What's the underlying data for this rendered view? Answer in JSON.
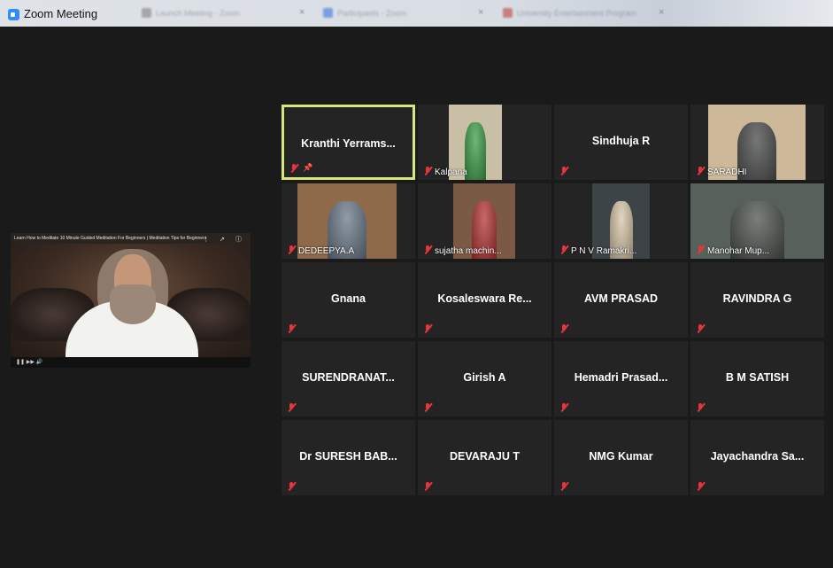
{
  "window": {
    "title": "Zoom Meeting",
    "blurred_tabs": [
      "Launch Meeting - Zoom",
      "Participants - Zoom",
      "University Entertainment Program"
    ]
  },
  "shared_screen": {
    "video_title": "Learn How to Meditate 10 Minute Guided Meditation For Beginners | Meditation Tips for Beginners",
    "controls": "⋮ ➚ ⓘ",
    "progress_fraction": 0.3
  },
  "participants": [
    {
      "name": "Kranthi  Yerrams...",
      "video": false,
      "muted": true,
      "pinned": true,
      "active_speaker": true
    },
    {
      "name": "Kalpana",
      "video": true,
      "muted": true
    },
    {
      "name": "Sindhuja R",
      "video": false,
      "muted": true
    },
    {
      "name": "SARADHI",
      "video": true,
      "muted": true
    },
    {
      "name": "DEDEEPYA.A",
      "video": true,
      "muted": true
    },
    {
      "name": "sujatha machin...",
      "video": true,
      "muted": true
    },
    {
      "name": "P N V Ramakri...",
      "video": true,
      "muted": true
    },
    {
      "name": "Manohar Mup...",
      "video": true,
      "muted": true
    },
    {
      "name": "Gnana",
      "video": false,
      "muted": true
    },
    {
      "name": "Kosaleswara  Re...",
      "video": false,
      "muted": true
    },
    {
      "name": "AVM PRASAD",
      "video": false,
      "muted": true
    },
    {
      "name": "RAVINDRA G",
      "video": false,
      "muted": true
    },
    {
      "name": "SURENDRANAT...",
      "video": false,
      "muted": true
    },
    {
      "name": "Girish A",
      "video": false,
      "muted": true
    },
    {
      "name": "Hemadri  Prasad...",
      "video": false,
      "muted": true
    },
    {
      "name": "B M SATISH",
      "video": false,
      "muted": true
    },
    {
      "name": "Dr SURESH BAB...",
      "video": false,
      "muted": true
    },
    {
      "name": "DEVARAJU T",
      "video": false,
      "muted": true
    },
    {
      "name": "NMG Kumar",
      "video": false,
      "muted": true
    },
    {
      "name": "Jayachandra  Sa...",
      "video": false,
      "muted": true
    }
  ],
  "colors": {
    "active_speaker_border": "#d7e57a",
    "muted_icon": "#e8353b",
    "tile_bg": "#242424"
  }
}
